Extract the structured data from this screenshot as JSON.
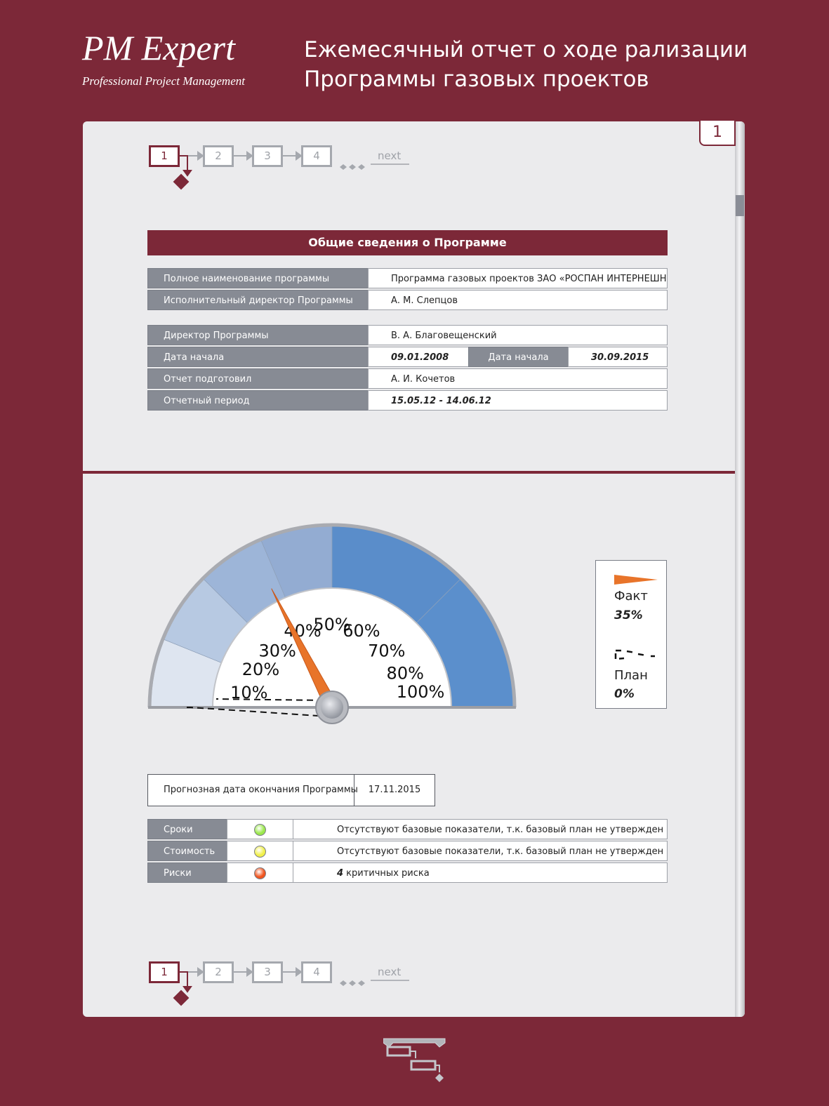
{
  "header": {
    "logo_main": "PM Expert",
    "logo_sub": "Professional Project Management",
    "title_line1": "Ежемесячный отчет о ходе рализации",
    "title_line2": "Программы газовых проектов"
  },
  "page_number": "1",
  "nav": {
    "items": [
      "1",
      "2",
      "3",
      "4"
    ],
    "next_label": "next",
    "active": "1"
  },
  "general": {
    "section_title": "Общие сведения о Программе",
    "full_name_label": "Полное наименование программы",
    "full_name_value": "Программа газовых проектов ЗАО «РОСПАН ИНТЕРНЕШНЛ»",
    "exec_director_label": "Исполнительный директор Программы",
    "exec_director_value": "А. М. Слепцов",
    "director_label": "Директор Программы",
    "director_value": "В. А. Благовещенский",
    "start_date_label": "Дата начала",
    "start_date_value": "09.01.2008",
    "end_date_label": "Дата начала",
    "end_date_value": "30.09.2015",
    "prepared_by_label": "Отчет подготовил",
    "prepared_by_value": "А. И. Кочетов",
    "period_label": "Отчетный период",
    "period_value": "15.05.12 - 14.06.12"
  },
  "gauge": {
    "tick_labels": [
      "10%",
      "20%",
      "30%",
      "40%",
      "50%",
      "60%",
      "70%",
      "80%",
      "100%"
    ],
    "fact_percent": 35,
    "plan_percent": 0,
    "segment_colors": [
      "#dee5f0",
      "#b7c9e2",
      "#9db5d8",
      "#93acd2",
      "#5a8dca",
      "#5b8fcc",
      "#335f96"
    ]
  },
  "legend": {
    "fact_label": "Факт",
    "fact_value": "35%",
    "plan_label": "План",
    "plan_value": "0%",
    "fact_color": "#e8742a"
  },
  "forecast": {
    "label": "Прогнозная дата окончания Программы",
    "value": "17.11.2015"
  },
  "status": [
    {
      "label": "Сроки",
      "color": "#9be84c",
      "text": "Отсутствуют базовые показатели, т.к. базовый план не утвержден"
    },
    {
      "label": "Стоимость",
      "color": "#f1f04a",
      "text": "Отсутствуют базовые показатели, т.к. базовый план не утвержден"
    },
    {
      "label": "Риски",
      "color": "#f0541e",
      "count": "4",
      "text": " критичных риска"
    }
  ]
}
